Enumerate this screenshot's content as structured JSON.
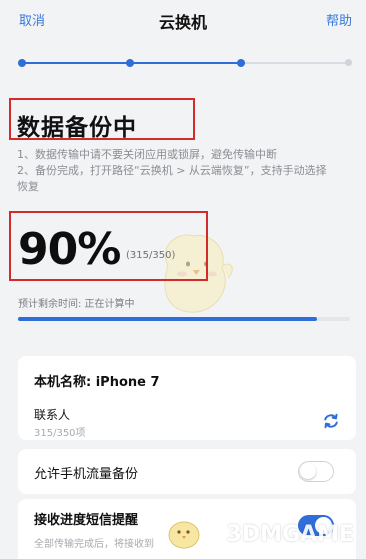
{
  "nav": {
    "cancel": "取消",
    "title": "云换机",
    "help": "帮助"
  },
  "steps": {
    "total": 4,
    "completed": 3
  },
  "status": {
    "headline": "数据备份中"
  },
  "notes": [
    "1、数据传输中请不要关闭应用或锁屏，避免传输中断",
    "2、备份完成，打开路径“云换机 > 从云端恢复”，支持手动选择",
    "恢复"
  ],
  "progress": {
    "percent_text": "90%",
    "count_text": "(315/350)",
    "fraction": 0.9,
    "eta_text": "预计剩余时间: 正在计算中"
  },
  "device": {
    "name_label": "本机名称: iPhone 7",
    "contacts_label": "联系人",
    "contacts_count": "315/350项",
    "sync_icon": "sync-icon"
  },
  "settings": {
    "mobile_data_label": "允许手机流量备份",
    "mobile_data_on": false,
    "sms_label": "接收进度短信提醒",
    "sms_sub": "全部传输完成后，将接收到",
    "sms_on": true
  },
  "watermark": {
    "text": "3DMGAME"
  },
  "colors": {
    "accent": "#2f6dd8",
    "highlight_box": "#d32a2a",
    "link": "#3a78d6"
  }
}
